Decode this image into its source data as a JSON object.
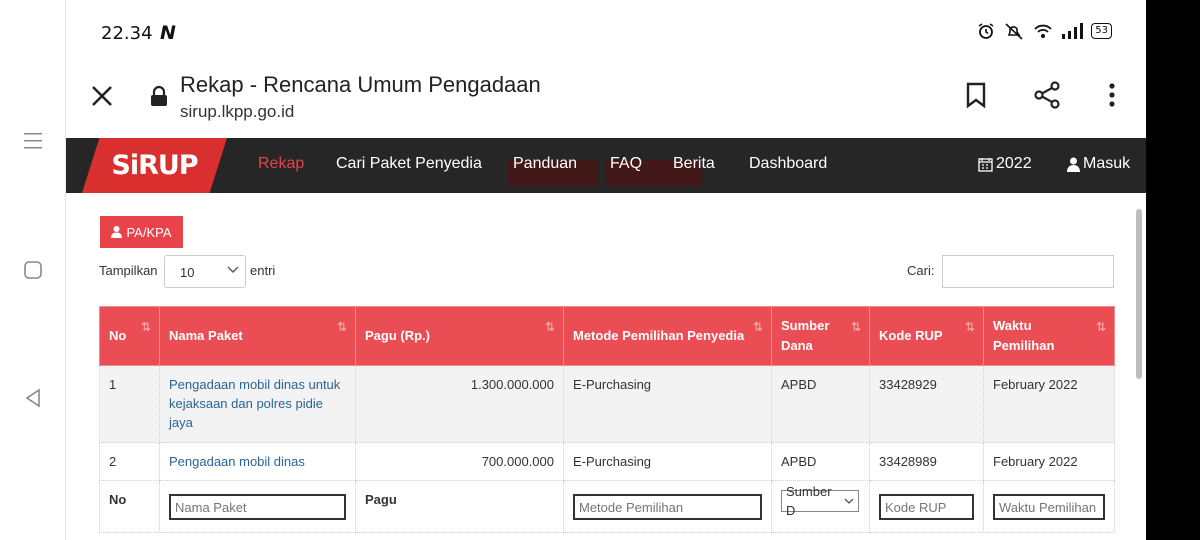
{
  "status": {
    "time": "22.34",
    "n": "N",
    "battery": "53"
  },
  "tab": {
    "title": "Rekap - Rencana Umum Pengadaan",
    "url": "sirup.lkpp.go.id"
  },
  "nav": {
    "logo": "SiRUP",
    "items": [
      "Rekap",
      "Cari Paket Penyedia",
      "Panduan",
      "FAQ",
      "Berita",
      "Dashboard"
    ],
    "year": "2022",
    "login": "Masuk"
  },
  "controls": {
    "pa_button": "PA/KPA",
    "show_label": "Tampilkan",
    "show_value": "10",
    "entries_label": "entri",
    "search_label": "Cari:"
  },
  "table": {
    "headers": [
      "No",
      "Nama Paket",
      "Pagu (Rp.)",
      "Metode Pemilihan Penyedia",
      "Sumber Dana",
      "Kode RUP",
      "Waktu Pemilihan"
    ],
    "rows": [
      {
        "no": "1",
        "nama": "Pengadaan mobil dinas untuk kejaksaan dan polres pidie jaya",
        "pagu": "1.300.000.000",
        "metode": "E-Purchasing",
        "sumber": "APBD",
        "kode": "33428929",
        "waktu": "February 2022"
      },
      {
        "no": "2",
        "nama": "Pengadaan mobil dinas",
        "pagu": "700.000.000",
        "metode": "E-Purchasing",
        "sumber": "APBD",
        "kode": "33428989",
        "waktu": "February 2022"
      }
    ],
    "footer": {
      "no": "No",
      "nama_placeholder": "Nama Paket",
      "pagu": "Pagu",
      "metode_placeholder": "Metode Pemilihan",
      "sumber_select": "Sumber D",
      "kode_placeholder": "Kode RUP",
      "waktu_placeholder": "Waktu Pemilihan"
    }
  },
  "colors": {
    "brand": "#e8434a",
    "nav_bg": "#262626",
    "link": "#2a6496"
  }
}
